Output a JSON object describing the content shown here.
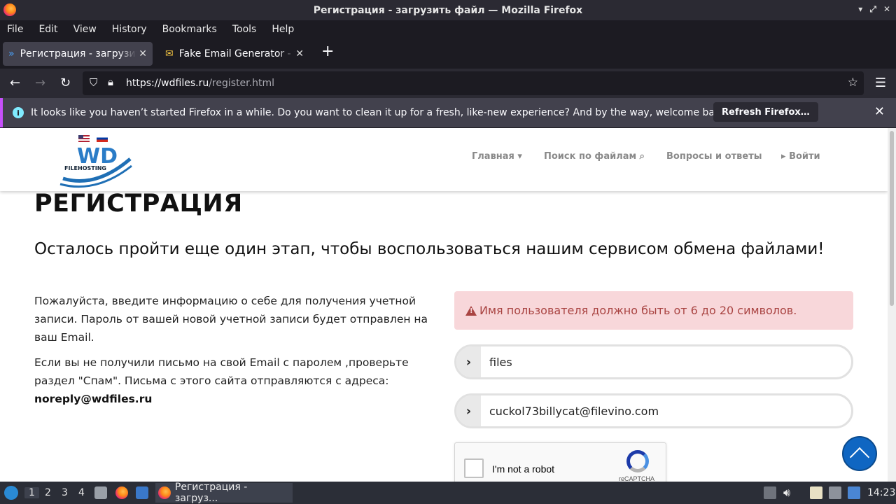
{
  "window": {
    "title": "Регистрация - загрузить файл — Mozilla Firefox",
    "controls": [
      "▾",
      "⤢",
      "✕"
    ]
  },
  "menubar": {
    "items": [
      "File",
      "Edit",
      "View",
      "History",
      "Bookmarks",
      "Tools",
      "Help"
    ]
  },
  "tabs": [
    {
      "label": "Регистрация - загрузить файл",
      "close": "✕"
    },
    {
      "label": "Fake Email Generator - temp mail",
      "close": "✕"
    }
  ],
  "newtab": "+",
  "navbar": {
    "url_host": "https://wdfiles.ru",
    "url_path": "/register.html"
  },
  "notification": {
    "message": "It looks like you haven’t started Firefox in a while. Do you want to clean it up for a fresh, like-new experience? And by the way, welcome back!",
    "button": "Refresh Firefox…",
    "info": "i",
    "close": "✕"
  },
  "site": {
    "logo_text": "WD",
    "logo_sub": "FILEHOSTING",
    "nav": {
      "home": "Главная ▾",
      "search": "Поиск по файлам",
      "faq": "Вопросы и ответы",
      "login": "Войти"
    },
    "heading": "РЕГИСТРАЦИЯ",
    "lead": "Осталось пройти еще один этап, чтобы воспользоваться нашим сервисом обмена файлами!",
    "para1": "Пожалуйста, введите информацию о себе для получения учетной записи. Пароль от вашей новой учетной записи будет отправлен на ваш Email.",
    "para2": "Если вы не получили письмо на свой Email с паролем ,проверьте раздел \"Спам\". Письма с этого сайта отправляются с адреса:",
    "email": "noreply@wdfiles.ru",
    "alert": "Имя пользователя должно быть от 6 до 20 символов.",
    "username_value": "files",
    "email_value": "cuckol73billycat@filevino.com",
    "captcha_label": "I'm not a robot",
    "captcha_brand": "reCAPTCHA"
  },
  "taskbar": {
    "workspaces": [
      "1",
      "2",
      "3",
      "4"
    ],
    "task_label": "Регистрация - загруз...",
    "clock": "14:23"
  }
}
